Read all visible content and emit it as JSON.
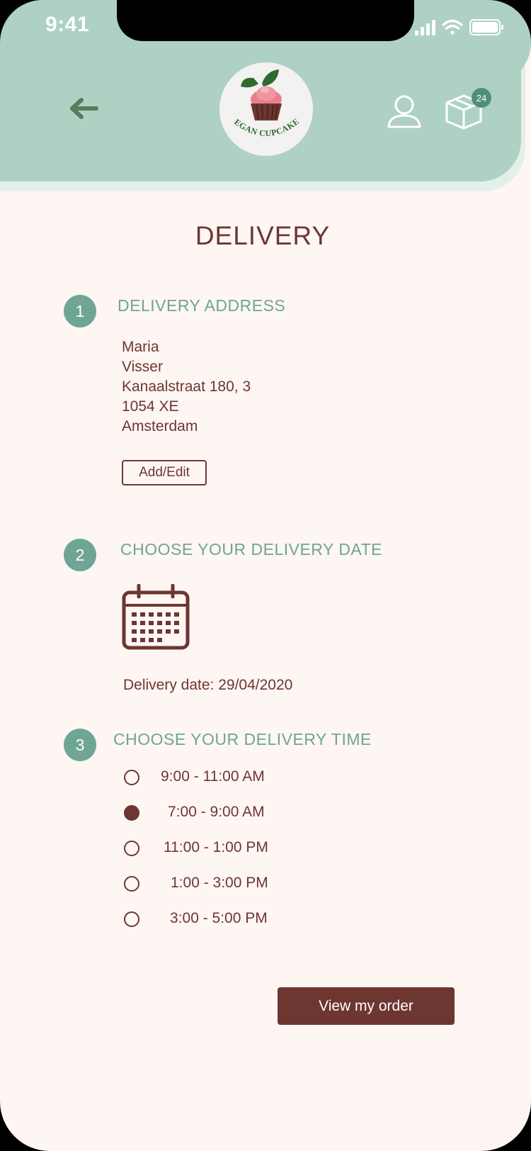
{
  "status_bar": {
    "time": "9:41"
  },
  "header": {
    "logo_text": "VEGAN CUPCAKES",
    "cart_count": "24",
    "icons": [
      "back-arrow-icon",
      "user-icon",
      "box-icon"
    ]
  },
  "page": {
    "title": "DELIVERY"
  },
  "steps": {
    "address": {
      "number": "1",
      "title": "DELIVERY ADDRESS",
      "lines": [
        "Maria",
        "Visser",
        "Kanaalstraat 180, 3",
        "1054 XE",
        "Amsterdam"
      ],
      "edit_label": "Add/Edit"
    },
    "date": {
      "number": "2",
      "title": "CHOOSE YOUR DELIVERY DATE",
      "date_text": "Delivery date: 29/04/2020"
    },
    "time": {
      "number": "3",
      "title": "CHOOSE YOUR DELIVERY TIME",
      "options": [
        {
          "label": "9:00 - 11:00 AM",
          "selected": false
        },
        {
          "label": "7:00 - 9:00 AM",
          "selected": true
        },
        {
          "label": "11:00 - 1:00 PM",
          "selected": false
        },
        {
          "label": "1:00 - 3:00 PM",
          "selected": false
        },
        {
          "label": "3:00 - 5:00 PM",
          "selected": false
        }
      ]
    }
  },
  "actions": {
    "view_order_label": "View my order"
  },
  "colors": {
    "header_bg": "#aed1c4",
    "page_bg": "#fdf6f3",
    "brown": "#6e3631",
    "teal": "#6fa595",
    "badge": "#4f8f79"
  }
}
